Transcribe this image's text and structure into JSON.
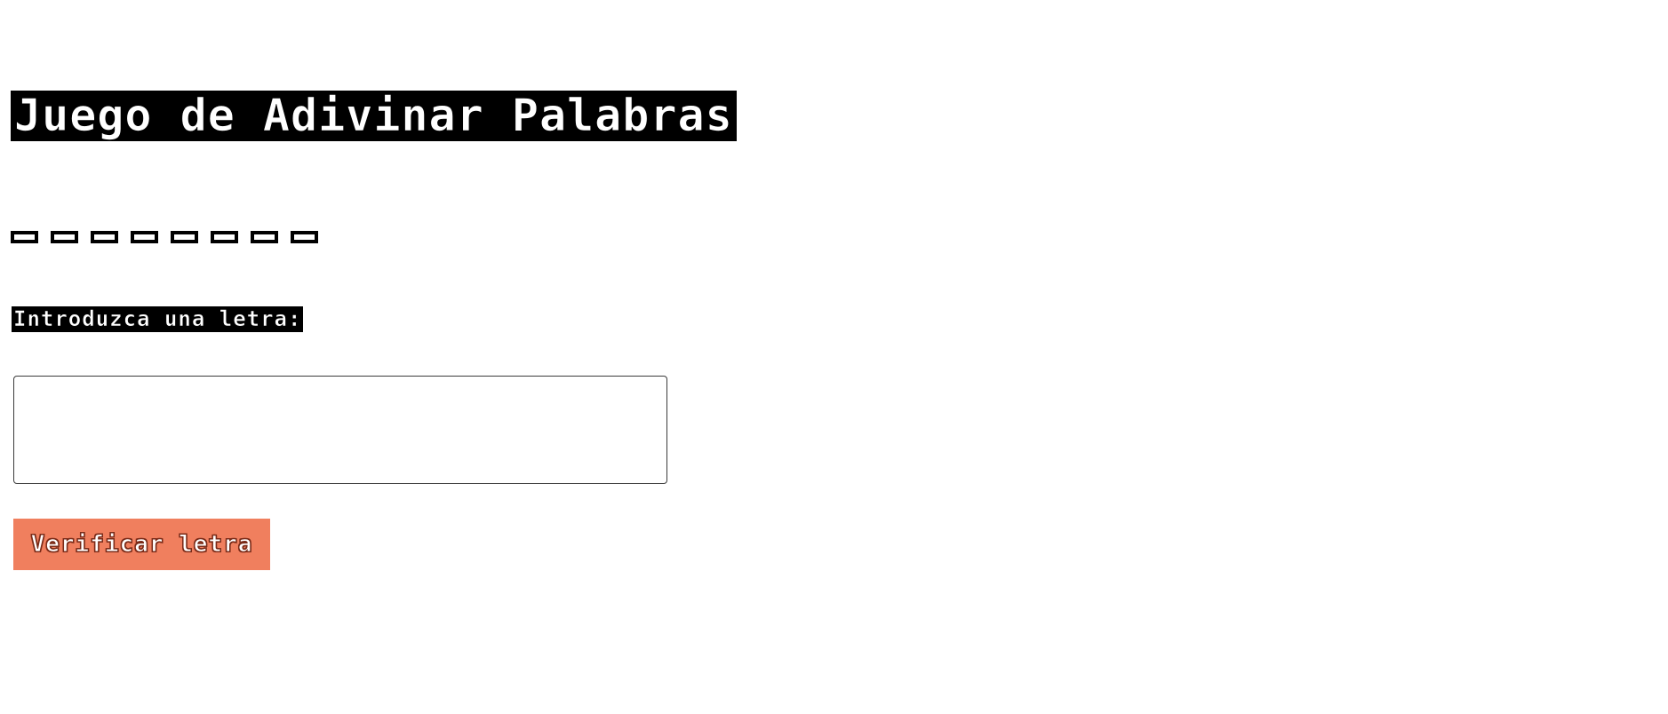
{
  "header": {
    "title": "Juego de Adivinar Palabras"
  },
  "word": {
    "letters": [
      "",
      "",
      "",
      "",
      "",
      "",
      "",
      ""
    ]
  },
  "form": {
    "prompt_label": "Introduzca una letra:",
    "input_value": "",
    "input_placeholder": "",
    "submit_label": "Verificar letra"
  },
  "colors": {
    "background": "#ffffff",
    "text": "#000000",
    "button_background": "#f07f5e",
    "button_text": "#ffffff",
    "input_border": "#3a3a3a"
  }
}
